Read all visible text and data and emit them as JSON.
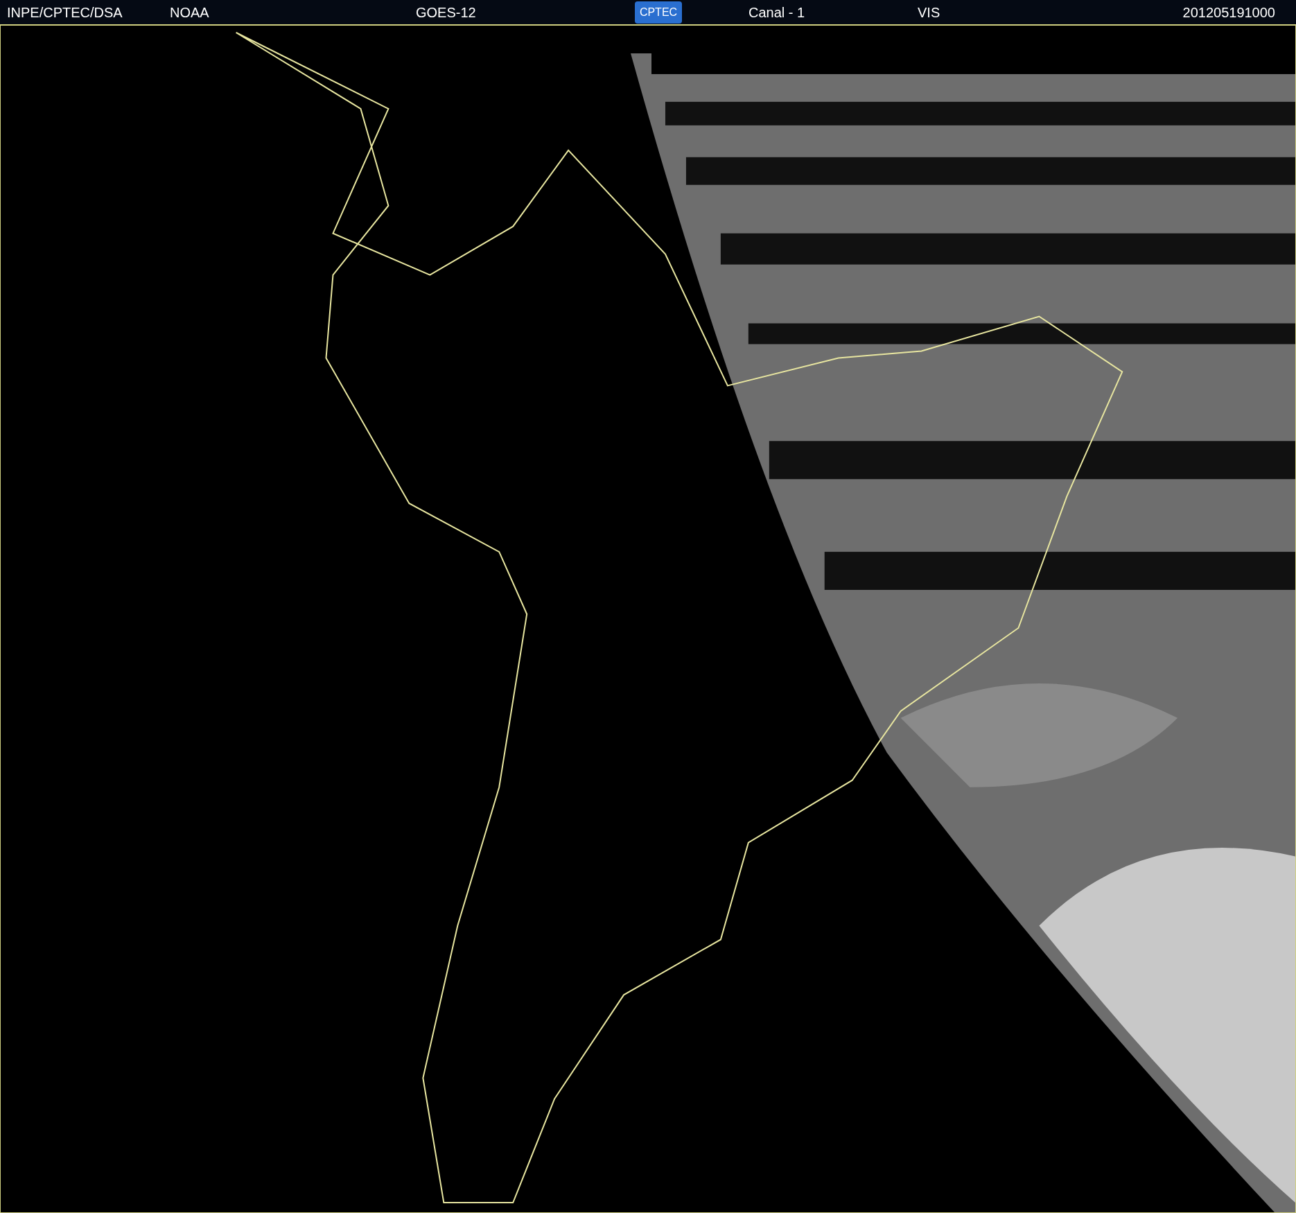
{
  "header": {
    "agency": "INPE/CPTEC/DSA",
    "source": "NOAA",
    "satellite": "GOES-12",
    "logo": "CPTEC",
    "channel": "Canal - 1",
    "band": "VIS",
    "timestamp": "201205191000"
  }
}
